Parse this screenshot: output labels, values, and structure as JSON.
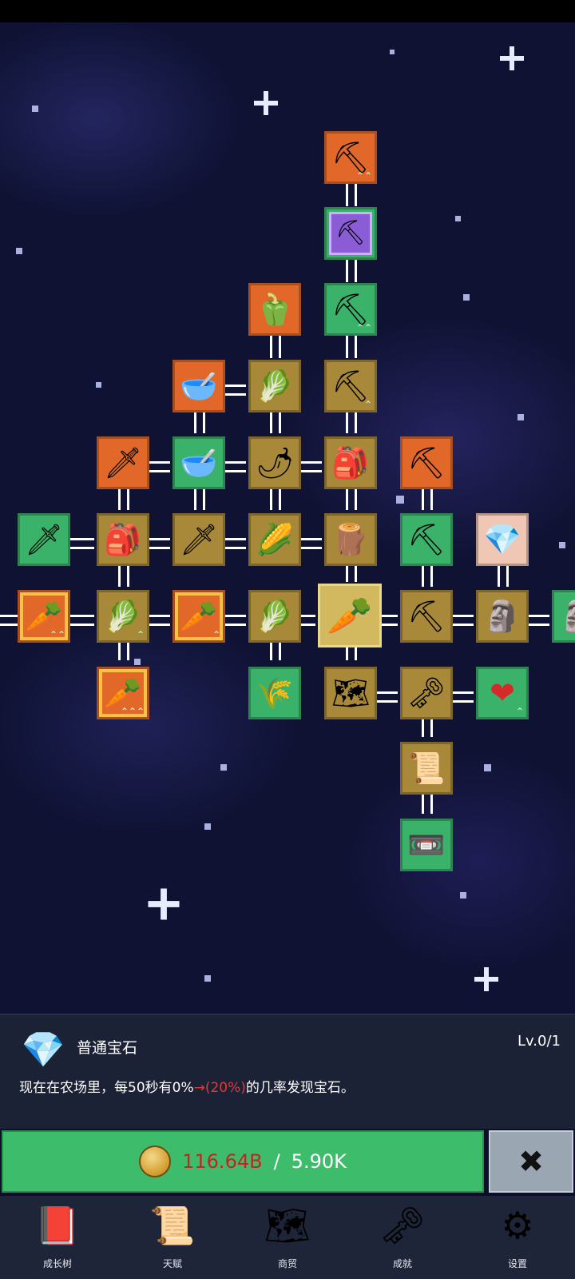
{
  "colors": {
    "node_orange": "#e2682a",
    "node_green": "#3bb26a",
    "node_brown": "#a8893a",
    "buy_button": "#3dbd6b",
    "cost_insufficient": "#c8231f",
    "chance_highlight": "#e03a3a",
    "close_button": "#9aa7b3"
  },
  "tree": {
    "nodes": [
      {
        "id": "n1",
        "icon": "shovel-icon",
        "glyph": "⛏",
        "up": "⌃⌃"
      },
      {
        "id": "n2",
        "icon": "shovel-purple-icon",
        "glyph": "⛏",
        "up": "⌃"
      },
      {
        "id": "n3",
        "icon": "shovel-icon",
        "glyph": "⛏",
        "up": "⌃⌃"
      },
      {
        "id": "n4",
        "icon": "bell-pepper-icon",
        "glyph": "🫑",
        "up": ""
      },
      {
        "id": "n5",
        "icon": "bowl-icon",
        "glyph": "🥣",
        "up": ""
      },
      {
        "id": "n6",
        "icon": "radish-icon",
        "glyph": "🥬",
        "up": ""
      },
      {
        "id": "n7",
        "icon": "shovel-icon",
        "glyph": "⛏",
        "up": "⌃"
      },
      {
        "id": "n8",
        "icon": "sword-icon",
        "glyph": "🗡",
        "up": ""
      },
      {
        "id": "n9",
        "icon": "bowl-icon",
        "glyph": "🥣",
        "up": ""
      },
      {
        "id": "n10",
        "icon": "chili-icon",
        "glyph": "🌶",
        "up": ""
      },
      {
        "id": "n11",
        "icon": "backpack-icon",
        "glyph": "🎒",
        "up": ""
      },
      {
        "id": "n12",
        "icon": "pickaxe-icon",
        "glyph": "⛏",
        "up": ""
      },
      {
        "id": "n13",
        "icon": "sword-icon",
        "glyph": "🗡",
        "up": ""
      },
      {
        "id": "n14",
        "icon": "backpack-icon",
        "glyph": "🎒",
        "up": ""
      },
      {
        "id": "n15",
        "icon": "sword-icon",
        "glyph": "🗡",
        "up": ""
      },
      {
        "id": "n16",
        "icon": "corn-icon",
        "glyph": "🌽",
        "up": ""
      },
      {
        "id": "n17",
        "icon": "wooden-staff-icon",
        "glyph": "🪵",
        "up": ""
      },
      {
        "id": "n18",
        "icon": "pickaxe-icon",
        "glyph": "⛏",
        "up": ""
      },
      {
        "id": "n19",
        "icon": "gem-icon",
        "glyph": "💎",
        "up": ""
      },
      {
        "id": "n20",
        "icon": "carrot-gold-icon",
        "glyph": "🥕",
        "up": "⌃⌃"
      },
      {
        "id": "n21",
        "icon": "cabbage-icon",
        "glyph": "🥬",
        "up": "⌃"
      },
      {
        "id": "n22",
        "icon": "carrot-gold-icon",
        "glyph": "🥕",
        "up": "⌃"
      },
      {
        "id": "n23",
        "icon": "cabbage-icon",
        "glyph": "🥬",
        "up": ""
      },
      {
        "id": "n24",
        "icon": "carrot-icon",
        "glyph": "🥕",
        "up": ""
      },
      {
        "id": "n25",
        "icon": "pickaxe-icon",
        "glyph": "⛏",
        "up": ""
      },
      {
        "id": "n26",
        "icon": "statue-icon",
        "glyph": "🗿",
        "up": ""
      },
      {
        "id": "n27",
        "icon": "statue-icon",
        "glyph": "🗿",
        "up": ""
      },
      {
        "id": "n28",
        "icon": "carrot-gold-icon",
        "glyph": "🥕",
        "up": "⌃⌃⌃"
      },
      {
        "id": "n29",
        "icon": "wheat-icon",
        "glyph": "🌾",
        "up": ""
      },
      {
        "id": "n30",
        "icon": "map-icon",
        "glyph": "🗺",
        "up": ""
      },
      {
        "id": "n31",
        "icon": "key-icon",
        "glyph": "🗝",
        "up": ""
      },
      {
        "id": "n32",
        "icon": "heart-icon",
        "glyph": "❤",
        "up": "⌃"
      },
      {
        "id": "n33",
        "icon": "scroll-icon",
        "glyph": "📜",
        "up": ""
      },
      {
        "id": "n34",
        "icon": "cassette-icon",
        "glyph": "📼",
        "up": ""
      }
    ]
  },
  "info": {
    "icon": "gem-icon",
    "title": "普通宝石",
    "level": "Lv.0/1",
    "desc_before": "现在在农场里，每50秒有0%",
    "desc_arrow": "→",
    "desc_highlight": "(20%)",
    "desc_after": "的几率发现宝石。"
  },
  "purchase": {
    "current": "116.64B",
    "separator": "/",
    "required": "5.90K"
  },
  "close": {
    "icon": "close-icon",
    "glyph": "✖"
  },
  "nav": [
    {
      "label": "成长树",
      "icon": "book-icon",
      "glyph": "📕"
    },
    {
      "label": "天赋",
      "icon": "scroll-icon",
      "glyph": "📜"
    },
    {
      "label": "商贸",
      "icon": "map-icon",
      "glyph": "🗺"
    },
    {
      "label": "成就",
      "icon": "key-icon",
      "glyph": "🗝"
    },
    {
      "label": "设置",
      "icon": "gear-icon",
      "glyph": "⚙"
    }
  ]
}
